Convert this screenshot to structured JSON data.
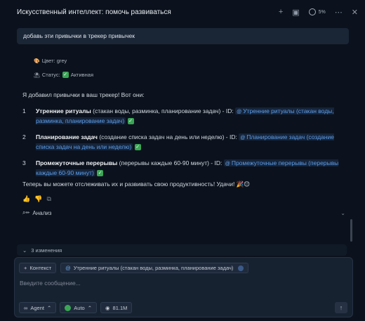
{
  "titlebar": {
    "title": "Искусственный интеллект: помочь развиваться",
    "context_percent": "5%",
    "icons": [
      "plus-icon",
      "history-icon",
      "context-ring-icon",
      "more-icon",
      "close-icon"
    ]
  },
  "user_message": "добавь эти привычки в трекер привычек",
  "meta": {
    "color_line": "Цвет: grey",
    "status_line": "Статус:",
    "status_value": "Активная"
  },
  "answer_intro": "Я добавил привычки в ваш трекер! Вот они:",
  "items": [
    {
      "num": "1",
      "title": "Утренние ритуалы",
      "desc": " (стакан воды, разминка, планирование задач) - ID: ",
      "link": "Утренние ритуалы (стакан воды, разминка, планирование задач)"
    },
    {
      "num": "2",
      "title": "Планирование задач",
      "desc": " (создание списка задач на день или неделю) - ID: ",
      "link": "Планирование задач (создание списка задач на день или неделю)"
    },
    {
      "num": "3",
      "title": "Промежуточные перерывы",
      "desc": " (перерывы каждые 60-90 минут) - ID: ",
      "link": "Промежуточные перерывы (перерывы каждые 60-90 минут)"
    }
  ],
  "closing": "Теперь вы можете отслеживать их и развивать свою продуктивность! Удачи! 🎉😊",
  "analysis_label": "Анализ",
  "changes_label": "3 изменения",
  "composer": {
    "context_chip": "Контекст",
    "attached_chip": "Утренние ритуалы (стакан воды, разминка, планирование задач)",
    "placeholder": "Введите сообщение...",
    "mode": "Agent",
    "model": "Auto",
    "tokens": "81.1M"
  },
  "colors": {
    "link": "#5b9ce8",
    "accent_green": "#3aa655",
    "background": "#0b121d"
  }
}
